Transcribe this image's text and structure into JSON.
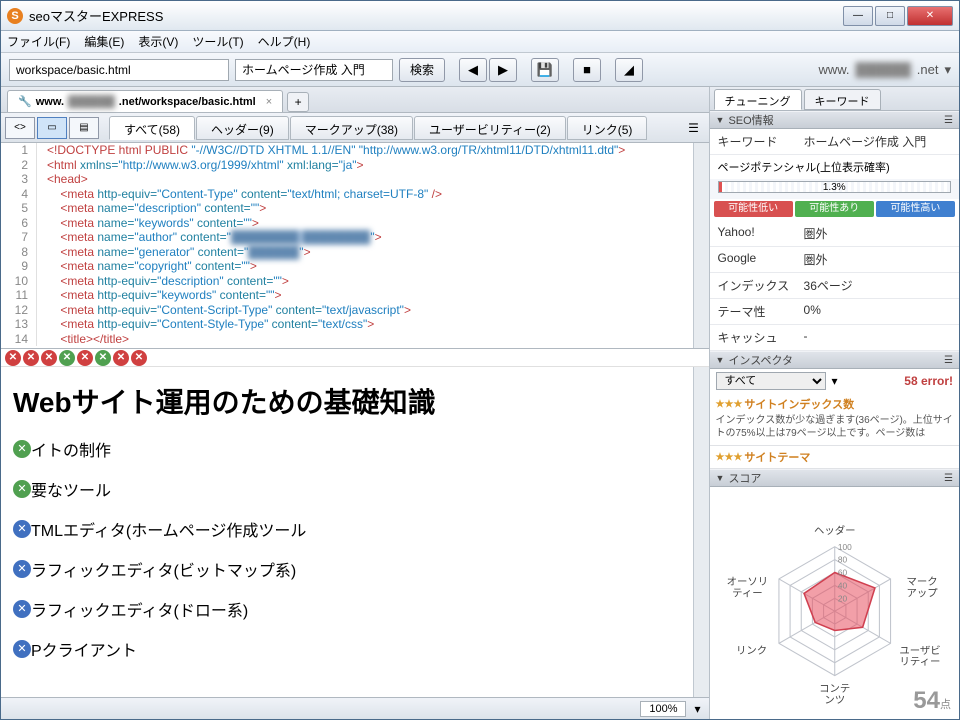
{
  "title": "seoマスターEXPRESS",
  "menubar": [
    "ファイル(F)",
    "編集(E)",
    "表示(V)",
    "ツール(T)",
    "ヘルプ(H)"
  ],
  "toolbar": {
    "path": "workspace/basic.html",
    "query": "ホームページ作成 入門",
    "search_btn": "検索",
    "domain_suffix": ".net"
  },
  "doc_tab": {
    "url_prefix": "www.",
    "url_suffix": ".net/workspace/basic.html"
  },
  "filter_tabs": [
    {
      "label": "すべて(58)",
      "active": true
    },
    {
      "label": "ヘッダー(9)"
    },
    {
      "label": "マークアップ(38)"
    },
    {
      "label": "ユーザービリティー(2)"
    },
    {
      "label": "リンク(5)"
    }
  ],
  "code_lines": [
    {
      "n": 1,
      "html": "<span class='c-tag'>&lt;!DOCTYPE html PUBLIC </span><span class='c-str'>\"-//W3C//DTD XHTML 1.1//EN\" \"http://www.w3.org/TR/xhtml11/DTD/xhtml11.dtd\"</span><span class='c-tag'>&gt;</span>"
    },
    {
      "n": 2,
      "html": "<span class='c-tag'>&lt;html </span><span class='c-attr'>xmlns=</span><span class='c-str'>\"http://www.w3.org/1999/xhtml\"</span> <span class='c-attr'>xml:lang=</span><span class='c-str'>\"ja\"</span><span class='c-tag'>&gt;</span>"
    },
    {
      "n": 3,
      "html": "<span class='c-tag'>&lt;head&gt;</span>"
    },
    {
      "n": 4,
      "html": "<span class='c-tag'>&lt;meta </span><span class='c-attr'>http-equiv=</span><span class='c-str'>\"Content-Type\"</span> <span class='c-attr'>content=</span><span class='c-str'>\"text/html; charset=UTF-8\"</span> <span class='c-tag'>/&gt;</span>"
    },
    {
      "n": 5,
      "html": "<span class='c-tag'>&lt;meta </span><span class='c-attr'>name=</span><span class='c-str'>\"description\"</span> <span class='c-attr'>content=</span><span class='c-str'>\"\"</span><span class='c-tag'>&gt;</span>"
    },
    {
      "n": 6,
      "html": "<span class='c-tag'>&lt;meta </span><span class='c-attr'>name=</span><span class='c-str'>\"keywords\"</span> <span class='c-attr'>content=</span><span class='c-str'>\"\"</span><span class='c-tag'>&gt;</span>"
    },
    {
      "n": 7,
      "html": "<span class='c-tag'>&lt;meta </span><span class='c-attr'>name=</span><span class='c-str'>\"author\"</span> <span class='c-attr'>content=</span><span class='c-str'>\"</span><span class='c-blur'>████████ ████████</span><span class='c-str'>\"</span><span class='c-tag'>&gt;</span>"
    },
    {
      "n": 8,
      "html": "<span class='c-tag'>&lt;meta </span><span class='c-attr'>name=</span><span class='c-str'>\"generator\"</span> <span class='c-attr'>content=</span><span class='c-str'>\"</span><span class='c-blur'>██████</span><span class='c-str'>\"</span><span class='c-tag'>&gt;</span>"
    },
    {
      "n": 9,
      "html": "<span class='c-tag'>&lt;meta </span><span class='c-attr'>name=</span><span class='c-str'>\"copyright\"</span> <span class='c-attr'>content=</span><span class='c-str'>\"\"</span><span class='c-tag'>&gt;</span>"
    },
    {
      "n": 10,
      "html": "<span class='c-tag'>&lt;meta </span><span class='c-attr'>http-equiv=</span><span class='c-str'>\"description\"</span> <span class='c-attr'>content=</span><span class='c-str'>\"\"</span><span class='c-tag'>&gt;</span>"
    },
    {
      "n": 11,
      "html": "<span class='c-tag'>&lt;meta </span><span class='c-attr'>http-equiv=</span><span class='c-str'>\"keywords\"</span> <span class='c-attr'>content=</span><span class='c-str'>\"\"</span><span class='c-tag'>&gt;</span>"
    },
    {
      "n": 12,
      "html": "<span class='c-tag'>&lt;meta </span><span class='c-attr'>http-equiv=</span><span class='c-str'>\"Content-Script-Type\"</span> <span class='c-attr'>content=</span><span class='c-str'>\"text/javascript\"</span><span class='c-tag'>&gt;</span>"
    },
    {
      "n": 13,
      "html": "<span class='c-tag'>&lt;meta </span><span class='c-attr'>http-equiv=</span><span class='c-str'>\"Content-Style-Type\"</span> <span class='c-attr'>content=</span><span class='c-str'>\"text/css\"</span><span class='c-tag'>&gt;</span>"
    },
    {
      "n": 14,
      "html": "<span class='c-tag'>&lt;title&gt;&lt;/title&gt;</span>"
    }
  ],
  "error_badges": [
    "r",
    "r",
    "r",
    "g",
    "r",
    "g",
    "r",
    "r"
  ],
  "preview": {
    "heading": "Webサイト運用のための基礎知識",
    "items": [
      {
        "badge": "g",
        "text": "イトの制作"
      },
      {
        "badge": "g",
        "text": "要なツール"
      },
      {
        "badge": "b",
        "text": "TMLエディタ(ホームページ作成ツール"
      },
      {
        "badge": "b",
        "text": "ラフィックエディタ(ビットマップ系)"
      },
      {
        "badge": "b",
        "text": "ラフィックエディタ(ドロー系)"
      },
      {
        "badge": "b",
        "text": "Pクライアント"
      }
    ]
  },
  "zoom": "100%",
  "right": {
    "tabs": [
      {
        "label": "チューニング",
        "active": true
      },
      {
        "label": "キーワード"
      }
    ],
    "seo_section": "SEO情報",
    "keyword_label": "キーワード",
    "keyword_value": "ホームページ作成 入門",
    "potential_label": "ページポテンシャル(上位表示確率)",
    "potential_pct": "1.3%",
    "legend": {
      "low": "可能性低い",
      "mid": "可能性あり",
      "high": "可能性高い"
    },
    "metrics": [
      {
        "k": "Yahoo!",
        "v": "圏外"
      },
      {
        "k": "Google",
        "v": "圏外"
      },
      {
        "k": "インデックス",
        "v": "36ページ"
      },
      {
        "k": "テーマ性",
        "v": "0%"
      },
      {
        "k": "キャッシュ",
        "v": "-"
      }
    ],
    "inspector_section": "インスペクタ",
    "inspector_filter": "すべて",
    "error_count": "58 error!",
    "insp_items": [
      {
        "title": "サイトインデックス数",
        "desc": "インデックス数が少な過ぎます(36ページ)。上位サイトの75%以上は79ページ以上です。ページ数は"
      },
      {
        "title": "サイトテーマ"
      }
    ],
    "score_section": "スコア",
    "radar_labels": [
      "ヘッダー",
      "マークアップ",
      "ユーザビリティー",
      "コンテンツ",
      "リンク",
      "オーソリティー"
    ],
    "radar_ticks": [
      "100",
      "80",
      "60",
      "40",
      "20"
    ],
    "score_value": "54",
    "score_unit": "点"
  },
  "chart_data": {
    "type": "radar",
    "categories": [
      "ヘッダー",
      "マークアップ",
      "ユーザビリティー",
      "コンテンツ",
      "リンク",
      "オーソリティー"
    ],
    "values": [
      60,
      72,
      50,
      30,
      35,
      55
    ],
    "max": 100,
    "ticks": [
      20,
      40,
      60,
      80,
      100
    ],
    "title": "スコア",
    "overall_score": 54
  }
}
